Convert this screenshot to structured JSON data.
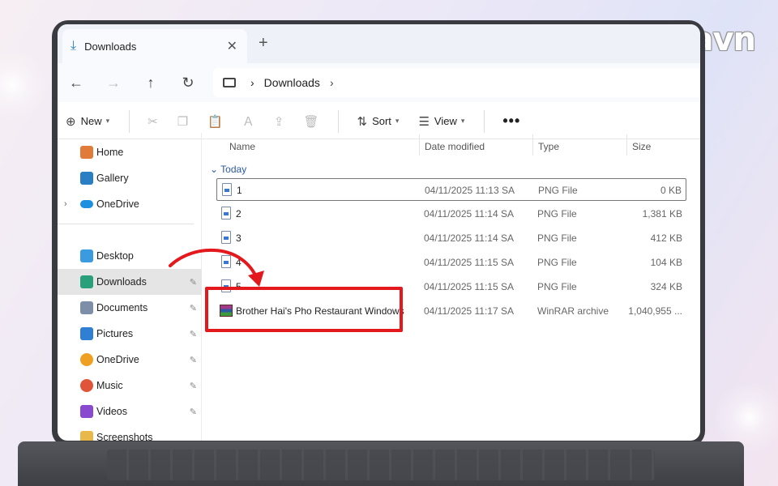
{
  "branding": {
    "logo_pre": "B",
    "logo_post": "ngdavn"
  },
  "window": {
    "tab_title": "Downloads",
    "close_glyph": "✕",
    "new_tab_glyph": "+"
  },
  "nav": {
    "back_glyph": "←",
    "forward_glyph": "→",
    "up_glyph": "↑",
    "refresh_glyph": "↻",
    "breadcrumb": "Downloads",
    "sep": "›"
  },
  "toolbar": {
    "new_label": "New",
    "sort_label": "Sort",
    "view_label": "View",
    "more_glyph": "•••",
    "icons": [
      "cut-icon",
      "copy-icon",
      "paste-icon",
      "rename-icon",
      "share-icon",
      "delete-icon"
    ]
  },
  "sidebar": {
    "items": [
      {
        "label": "Home",
        "icon": "home-icon",
        "color": "#e07b39"
      },
      {
        "label": "Gallery",
        "icon": "gallery-icon",
        "color": "#2a7ec4"
      },
      {
        "label": "OneDrive",
        "icon": "onedrive-icon",
        "color": "#1f8fe0"
      },
      {
        "label": "Desktop",
        "icon": "desktop-icon",
        "color": "#3a9be0"
      },
      {
        "label": "Downloads",
        "icon": "download-icon",
        "color": "#2aa07a"
      },
      {
        "label": "Documents",
        "icon": "documents-icon",
        "color": "#7d8fa8"
      },
      {
        "label": "Pictures",
        "icon": "pictures-icon",
        "color": "#2f7fd4"
      },
      {
        "label": "OneDrive",
        "icon": "onedrive-icon",
        "color": "#f0a020"
      },
      {
        "label": "Music",
        "icon": "music-icon",
        "color": "#e0543a"
      },
      {
        "label": "Videos",
        "icon": "videos-icon",
        "color": "#8a4ad0"
      },
      {
        "label": "Screenshots",
        "icon": "folder-icon",
        "color": "#e8b84a"
      }
    ],
    "pin_glyph": "📌"
  },
  "columns": {
    "name": "Name",
    "date": "Date modified",
    "type": "Type",
    "size": "Size"
  },
  "group_label": "Today",
  "files": [
    {
      "name": "1",
      "date": "04/11/2025 11:13 SA",
      "type": "PNG File",
      "size": "0 KB"
    },
    {
      "name": "2",
      "date": "04/11/2025 11:14 SA",
      "type": "PNG File",
      "size": "1,381 KB"
    },
    {
      "name": "3",
      "date": "04/11/2025 11:14 SA",
      "type": "PNG File",
      "size": "412 KB"
    },
    {
      "name": "4",
      "date": "04/11/2025 11:15 SA",
      "type": "PNG File",
      "size": "104 KB"
    },
    {
      "name": "5",
      "date": "04/11/2025 11:15 SA",
      "type": "PNG File",
      "size": "324 KB"
    },
    {
      "name": "Brother Hai's Pho Restaurant Windows",
      "date": "04/11/2025 11:17 SA",
      "type": "WinRAR archive",
      "size": "1,040,955 ..."
    }
  ],
  "accent_color": "#e3191d"
}
